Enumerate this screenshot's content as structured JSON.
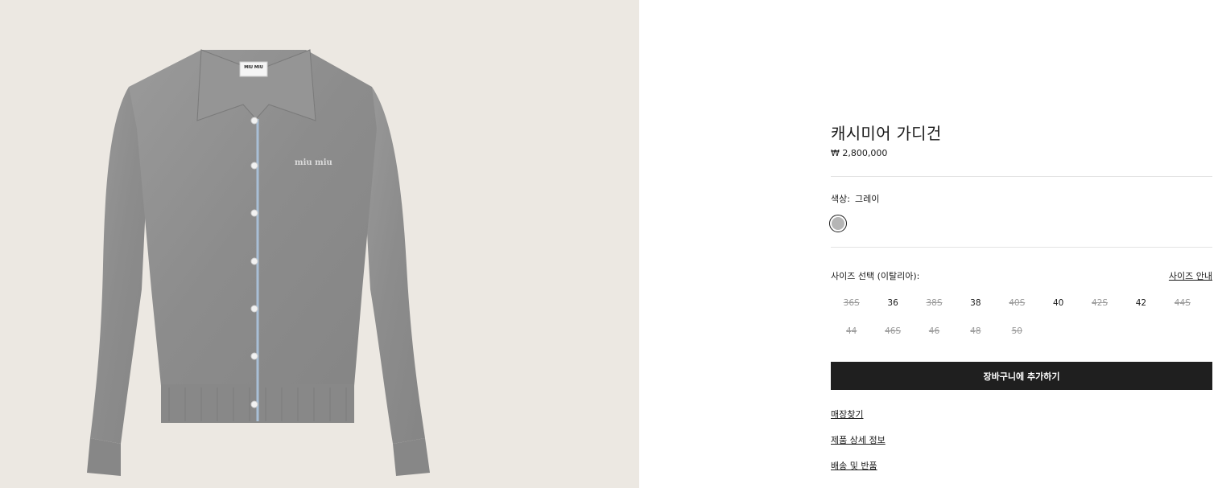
{
  "product": {
    "name": "캐시미어 가디건",
    "price": "₩ 2,800,000",
    "brand_label": "MIU MIU",
    "embroidery": "miu miu",
    "image_alt": "cashmere-cardigan-photo"
  },
  "color": {
    "label": "색상:",
    "value": "그레이",
    "swatch_hex": "#b5b5b5"
  },
  "size": {
    "label": "사이즈 선택 (이탈리아):",
    "guide_link": "사이즈 안내",
    "options": [
      {
        "label": "36S",
        "available": false
      },
      {
        "label": "36",
        "available": true
      },
      {
        "label": "38S",
        "available": false
      },
      {
        "label": "38",
        "available": true
      },
      {
        "label": "40S",
        "available": false
      },
      {
        "label": "40",
        "available": true
      },
      {
        "label": "42S",
        "available": false
      },
      {
        "label": "42",
        "available": true
      },
      {
        "label": "44S",
        "available": false
      },
      {
        "label": "44",
        "available": false
      },
      {
        "label": "46S",
        "available": false
      },
      {
        "label": "46",
        "available": false
      },
      {
        "label": "48",
        "available": false
      },
      {
        "label": "50",
        "available": false
      }
    ]
  },
  "actions": {
    "add_to_cart": "장바구니에 추가하기"
  },
  "links": [
    {
      "label": "매장찾기"
    },
    {
      "label": "제품 상세 정보"
    },
    {
      "label": "배송 및 반품"
    }
  ],
  "colors": {
    "button_bg": "#1f1f1f",
    "image_bg": "#ece8e2",
    "garment": "#8e8e8e"
  }
}
